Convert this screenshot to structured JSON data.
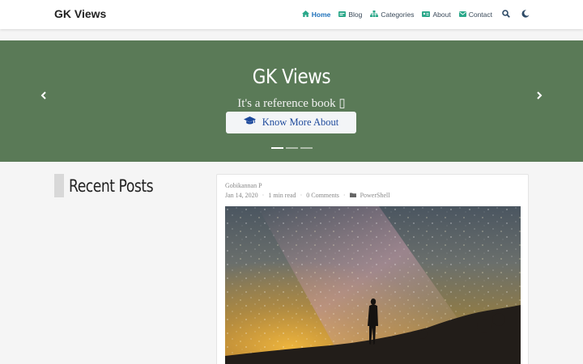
{
  "brand": "GK Views",
  "nav": {
    "home": "Home",
    "blog": "Blog",
    "categories": "Categories",
    "about": "About",
    "contact": "Contact"
  },
  "hero": {
    "title": "GK Views",
    "subtitle": "It's a reference book ▯",
    "button_label": "Know More About",
    "slide_count": 3,
    "active_slide": 1
  },
  "sidebar": {
    "title": "Recent Posts"
  },
  "post": {
    "author": "Gobikannan P",
    "date": "Jan 14, 2020",
    "read_time": "1 min read",
    "comments": "0 Comments",
    "category": "PowerShell"
  },
  "colors": {
    "hero_bg": "#5a7a57",
    "nav_active": "#1f72bb",
    "nav_icon": "#2ba88a",
    "button_text": "#1e4a9c"
  }
}
